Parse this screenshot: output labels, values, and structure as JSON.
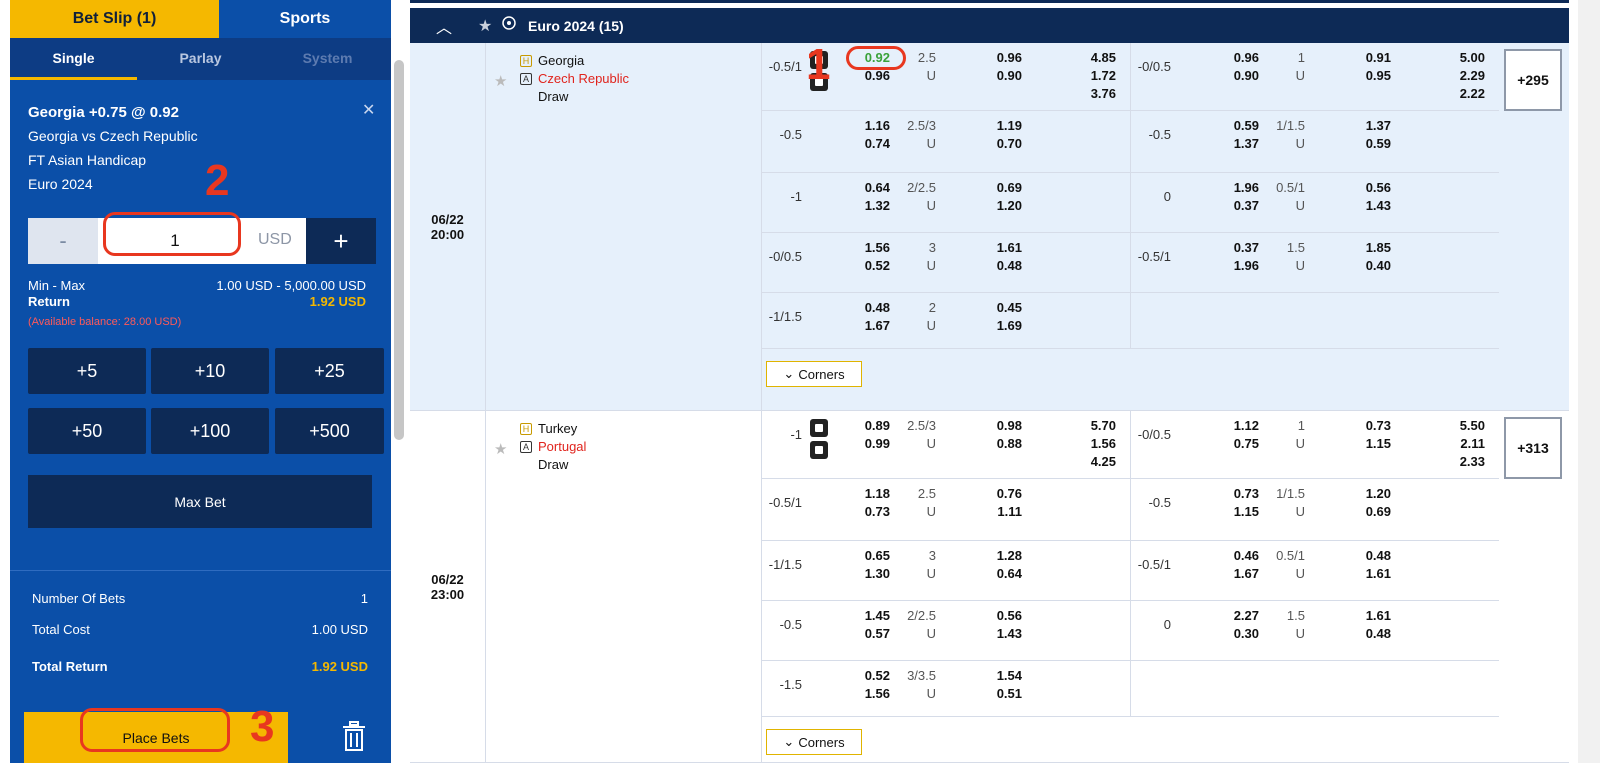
{
  "slip": {
    "tabs": {
      "betslip": "Bet Slip (1)",
      "sports": "Sports"
    },
    "subtabs": {
      "single": "Single",
      "parlay": "Parlay",
      "system": "System"
    },
    "selection": {
      "title": "Georgia +0.75 @ 0.92",
      "match": "Georgia vs Czech Republic",
      "market": "FT Asian Handicap",
      "league": "Euro 2024"
    },
    "stake": {
      "minus": "-",
      "value": "1",
      "currency": "USD",
      "plus": "+"
    },
    "limits": {
      "label": "Min - Max",
      "value": "1.00 USD - 5,000.00 USD"
    },
    "return": {
      "label": "Return",
      "value": "1.92 USD"
    },
    "available": "(Available balance: 28.00 USD)",
    "quick": [
      "+5",
      "+10",
      "+25",
      "+50",
      "+100",
      "+500"
    ],
    "max_bet": "Max Bet",
    "summary": {
      "bets_label": "Number Of Bets",
      "bets_value": "1",
      "cost_label": "Total Cost",
      "cost_value": "1.00 USD",
      "return_label": "Total Return",
      "return_value": "1.92 USD"
    },
    "place": "Place Bets"
  },
  "annotations": [
    "1",
    "2",
    "3"
  ],
  "league": {
    "chevron": "^",
    "star": "★",
    "name": "Euro 2024 (15)"
  },
  "matches": [
    {
      "date": "06/22",
      "time": "20:00",
      "home": "Georgia",
      "away": "Czech Republic",
      "draw": "Draw",
      "home_badge": "H",
      "away_badge": "A",
      "more": "+295",
      "corners": "Corners",
      "rows": [
        {
          "l": {
            "hdp": "-0.5/1",
            "o1": [
              "0.92",
              "0.96"
            ],
            "g": [
              "2.5",
              "U"
            ],
            "o2": [
              "0.96",
              "0.90"
            ],
            "o3": [
              "4.85",
              "1.72",
              "3.76"
            ]
          },
          "r": {
            "hdp": "-0/0.5",
            "o1": [
              "0.96",
              "0.90"
            ],
            "g": [
              "1",
              "U"
            ],
            "o2": [
              "0.91",
              "0.95"
            ],
            "o3": [
              "5.00",
              "2.29",
              "2.22"
            ]
          }
        },
        {
          "l": {
            "hdp": "-0.5",
            "o1": [
              "1.16",
              "0.74"
            ],
            "g": [
              "2.5/3",
              "U"
            ],
            "o2": [
              "1.19",
              "0.70"
            ]
          },
          "r": {
            "hdp": "-0.5",
            "o1": [
              "0.59",
              "1.37"
            ],
            "g": [
              "1/1.5",
              "U"
            ],
            "o2": [
              "1.37",
              "0.59"
            ]
          }
        },
        {
          "l": {
            "hdp": "-1",
            "o1": [
              "0.64",
              "1.32"
            ],
            "g": [
              "2/2.5",
              "U"
            ],
            "o2": [
              "0.69",
              "1.20"
            ]
          },
          "r": {
            "hdp": "0",
            "o1": [
              "1.96",
              "0.37"
            ],
            "g": [
              "0.5/1",
              "U"
            ],
            "o2": [
              "0.56",
              "1.43"
            ]
          }
        },
        {
          "l": {
            "hdp": "-0/0.5",
            "o1": [
              "1.56",
              "0.52"
            ],
            "g": [
              "3",
              "U"
            ],
            "o2": [
              "1.61",
              "0.48"
            ]
          },
          "r": {
            "hdp": "-0.5/1",
            "o1": [
              "0.37",
              "1.96"
            ],
            "g": [
              "1.5",
              "U"
            ],
            "o2": [
              "1.85",
              "0.40"
            ]
          }
        },
        {
          "l": {
            "hdp": "-1/1.5",
            "o1": [
              "0.48",
              "1.67"
            ],
            "g": [
              "2",
              "U"
            ],
            "o2": [
              "0.45",
              "1.69"
            ]
          },
          "r": null
        }
      ]
    },
    {
      "date": "06/22",
      "time": "23:00",
      "home": "Turkey",
      "away": "Portugal",
      "draw": "Draw",
      "home_badge": "H",
      "away_badge": "A",
      "more": "+313",
      "corners": "Corners",
      "rows": [
        {
          "l": {
            "hdp": "-1",
            "o1": [
              "0.89",
              "0.99"
            ],
            "g": [
              "2.5/3",
              "U"
            ],
            "o2": [
              "0.98",
              "0.88"
            ],
            "o3": [
              "5.70",
              "1.56",
              "4.25"
            ]
          },
          "r": {
            "hdp": "-0/0.5",
            "o1": [
              "1.12",
              "0.75"
            ],
            "g": [
              "1",
              "U"
            ],
            "o2": [
              "0.73",
              "1.15"
            ],
            "o3": [
              "5.50",
              "2.11",
              "2.33"
            ]
          }
        },
        {
          "l": {
            "hdp": "-0.5/1",
            "o1": [
              "1.18",
              "0.73"
            ],
            "g": [
              "2.5",
              "U"
            ],
            "o2": [
              "0.76",
              "1.11"
            ]
          },
          "r": {
            "hdp": "-0.5",
            "o1": [
              "0.73",
              "1.15"
            ],
            "g": [
              "1/1.5",
              "U"
            ],
            "o2": [
              "1.20",
              "0.69"
            ]
          }
        },
        {
          "l": {
            "hdp": "-1/1.5",
            "o1": [
              "0.65",
              "1.30"
            ],
            "g": [
              "3",
              "U"
            ],
            "o2": [
              "1.28",
              "0.64"
            ]
          },
          "r": {
            "hdp": "-0.5/1",
            "o1": [
              "0.46",
              "1.67"
            ],
            "g": [
              "0.5/1",
              "U"
            ],
            "o2": [
              "0.48",
              "1.61"
            ]
          }
        },
        {
          "l": {
            "hdp": "-0.5",
            "o1": [
              "1.45",
              "0.57"
            ],
            "g": [
              "2/2.5",
              "U"
            ],
            "o2": [
              "0.56",
              "1.43"
            ]
          },
          "r": {
            "hdp": "0",
            "o1": [
              "2.27",
              "0.30"
            ],
            "g": [
              "1.5",
              "U"
            ],
            "o2": [
              "1.61",
              "0.48"
            ]
          }
        },
        {
          "l": {
            "hdp": "-1.5",
            "o1": [
              "0.52",
              "1.56"
            ],
            "g": [
              "3/3.5",
              "U"
            ],
            "o2": [
              "1.54",
              "0.51"
            ]
          },
          "r": null
        }
      ]
    }
  ],
  "colors": {
    "slip_bg": "#0b4fa8",
    "accent": "#f5b800",
    "dark": "#0d2a56",
    "highlight_row": "#e6f0fb",
    "annotation": "#e8371f"
  }
}
